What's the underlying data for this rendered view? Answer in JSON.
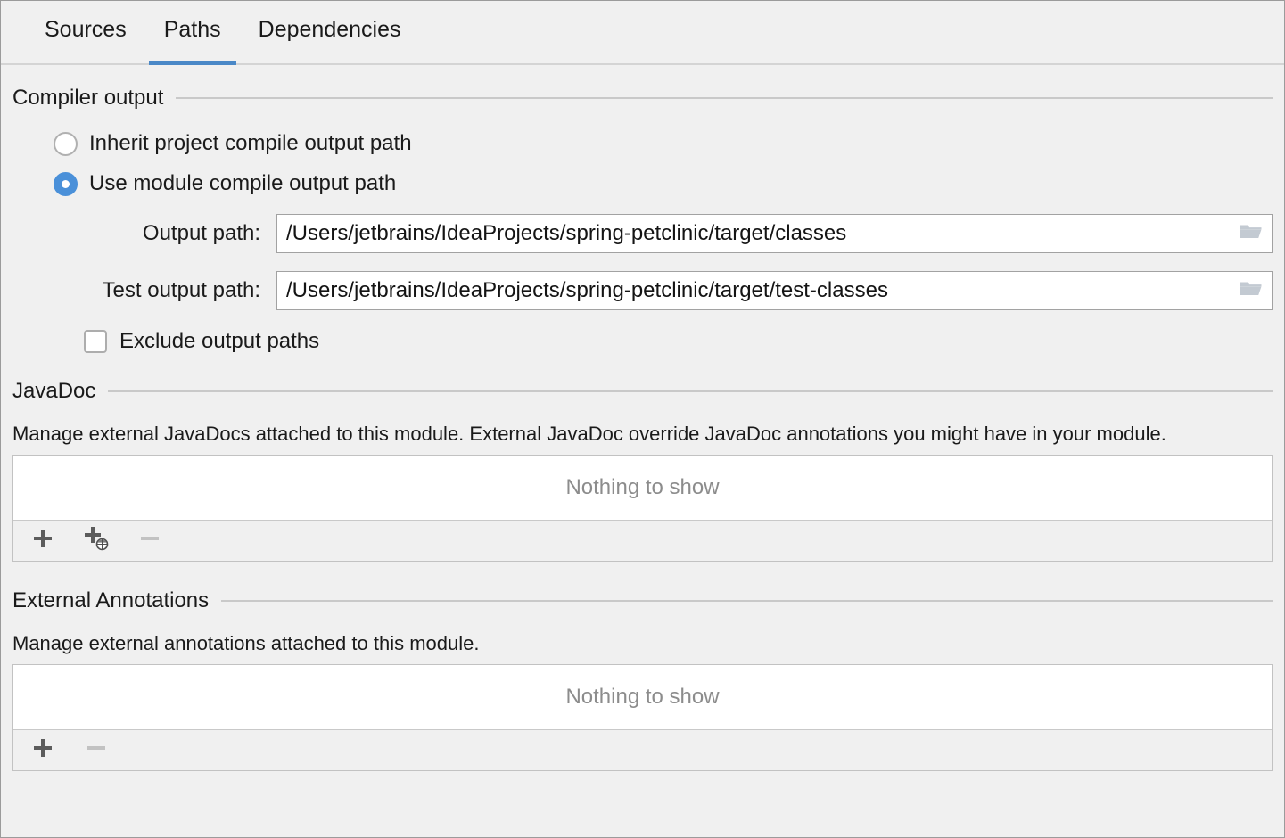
{
  "tabs": [
    {
      "label": "Sources",
      "active": false
    },
    {
      "label": "Paths",
      "active": true
    },
    {
      "label": "Dependencies",
      "active": false
    }
  ],
  "colors": {
    "accent": "#4a88c7",
    "radio_selected": "#4a90d9",
    "panel_bg": "#f0f0f0",
    "field_bg": "#ffffff",
    "placeholder_text": "#8c8c8c",
    "border": "#9b9b9b"
  },
  "compiler_output": {
    "section_title": "Compiler output",
    "inherit_option": {
      "label": "Inherit project compile output path",
      "selected": false
    },
    "module_option": {
      "label": "Use module compile output path",
      "selected": true
    },
    "output_path": {
      "label": "Output path:",
      "value": "/Users/jetbrains/IdeaProjects/spring-petclinic/target/classes",
      "browse_icon": "folder-icon"
    },
    "test_output_path": {
      "label": "Test output path:",
      "value": "/Users/jetbrains/IdeaProjects/spring-petclinic/target/test-classes",
      "browse_icon": "folder-icon"
    },
    "exclude_checkbox": {
      "label": "Exclude output paths",
      "checked": false
    }
  },
  "javadoc": {
    "section_title": "JavaDoc",
    "description": "Manage external JavaDocs attached to this module. External JavaDoc override JavaDoc annotations you might have in your module.",
    "empty_text": "Nothing to show",
    "toolbar": {
      "add_label": "+",
      "add_url_label": "+",
      "remove_label": "−"
    }
  },
  "external_annotations": {
    "section_title": "External Annotations",
    "description": "Manage external annotations attached to this module.",
    "empty_text": "Nothing to show",
    "toolbar": {
      "add_label": "+",
      "remove_label": "−"
    }
  }
}
